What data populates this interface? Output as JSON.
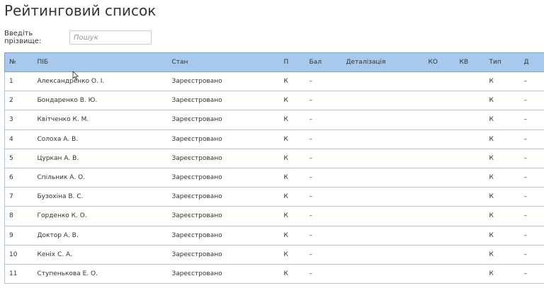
{
  "page": {
    "title": "Рейтинговий список"
  },
  "search": {
    "label": "Введіть прізвище:",
    "placeholder": "Пошук",
    "value": ""
  },
  "table": {
    "columns": [
      "№",
      "ПІБ",
      "Стан",
      "П",
      "Бал",
      "Деталізація",
      "КО",
      "КВ",
      "Тип",
      "Д"
    ],
    "rows": [
      {
        "num": "1",
        "name": "Александренко О. І.",
        "status": "Зареєстровано",
        "p": "К",
        "score": "–",
        "details": "",
        "ko": "",
        "kv": "",
        "type": "К",
        "d": "–"
      },
      {
        "num": "2",
        "name": "Бондаренко В. Ю.",
        "status": "Зареєстровано",
        "p": "К",
        "score": "–",
        "details": "",
        "ko": "",
        "kv": "",
        "type": "К",
        "d": "–"
      },
      {
        "num": "3",
        "name": "Квітченко К. М.",
        "status": "Зареєстровано",
        "p": "К",
        "score": "–",
        "details": "",
        "ko": "",
        "kv": "",
        "type": "К",
        "d": "–"
      },
      {
        "num": "4",
        "name": "Солоха А. В.",
        "status": "Зареєстровано",
        "p": "К",
        "score": "–",
        "details": "",
        "ko": "",
        "kv": "",
        "type": "К",
        "d": "–"
      },
      {
        "num": "5",
        "name": "Цуркан А. В.",
        "status": "Зареєстровано",
        "p": "К",
        "score": "–",
        "details": "",
        "ko": "",
        "kv": "",
        "type": "К",
        "d": "–"
      },
      {
        "num": "6",
        "name": "Спільник А. О.",
        "status": "Зареєстровано",
        "p": "К",
        "score": "–",
        "details": "",
        "ko": "",
        "kv": "",
        "type": "К",
        "d": "–"
      },
      {
        "num": "7",
        "name": "Бузохіна В. С.",
        "status": "Зареєстровано",
        "p": "К",
        "score": "–",
        "details": "",
        "ko": "",
        "kv": "",
        "type": "К",
        "d": "–"
      },
      {
        "num": "8",
        "name": "Горденко К. О.",
        "status": "Зареєстровано",
        "p": "К",
        "score": "–",
        "details": "",
        "ko": "",
        "kv": "",
        "type": "К",
        "d": "–"
      },
      {
        "num": "9",
        "name": "Доктор А. В.",
        "status": "Зареєстровано",
        "p": "К",
        "score": "–",
        "details": "",
        "ko": "",
        "kv": "",
        "type": "К",
        "d": "–"
      },
      {
        "num": "10",
        "name": "Кеніх С. А.",
        "status": "Зареєстровано",
        "p": "К",
        "score": "–",
        "details": "",
        "ko": "",
        "kv": "",
        "type": "К",
        "d": "–"
      },
      {
        "num": "11",
        "name": "Ступенькова Е. О.",
        "status": "Зареєстровано",
        "p": "К",
        "score": "–",
        "details": "",
        "ko": "",
        "kv": "",
        "type": "К",
        "d": "–"
      }
    ]
  },
  "colors": {
    "header_bg": "#a8c8ec",
    "row_border": "#b0c4dc",
    "text": "#333333"
  }
}
